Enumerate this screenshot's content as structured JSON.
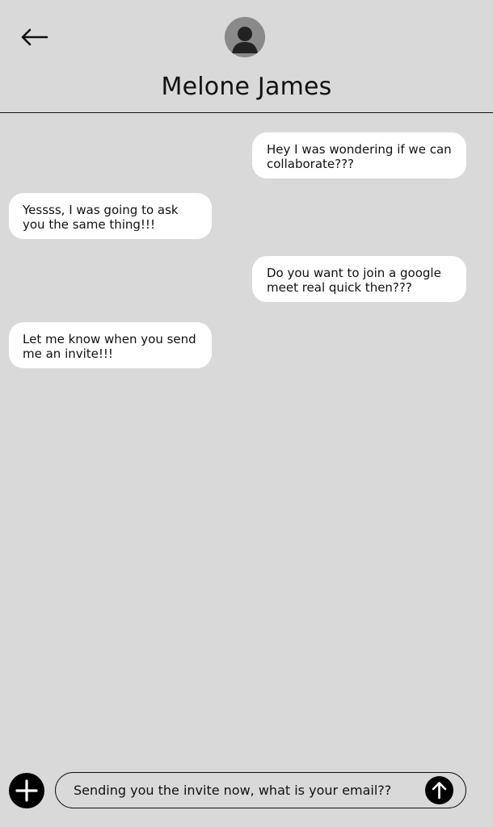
{
  "header": {
    "back_icon": "arrow-left-icon",
    "avatar_icon": "user-avatar-icon",
    "contact_name": "Melone James"
  },
  "messages": [
    {
      "direction": "outgoing",
      "text": "Hey I was wondering if we can collaborate???"
    },
    {
      "direction": "incoming",
      "text": "Yessss, I was going to ask you the same thing!!!"
    },
    {
      "direction": "outgoing",
      "text": "Do you want to join a google meet real quick then???"
    },
    {
      "direction": "incoming",
      "text": "Let me know when you send me an invite!!!"
    }
  ],
  "composer": {
    "add_icon": "plus-icon",
    "value": "Sending you the invite now, what is your email??",
    "send_icon": "arrow-up-icon"
  },
  "colors": {
    "background": "#d9d9d9",
    "bubble": "#ffffff",
    "text": "#111111",
    "button": "#000000",
    "avatar": "#8a8a8a"
  }
}
